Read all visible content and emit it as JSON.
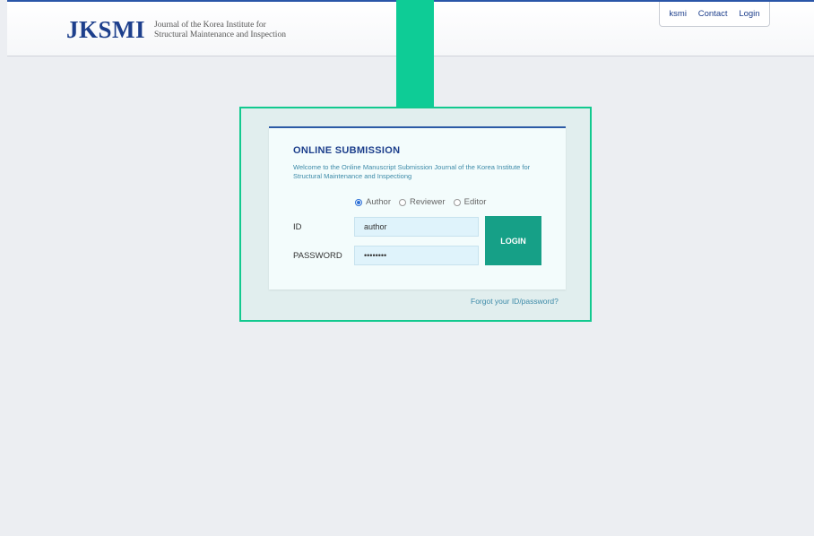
{
  "header": {
    "logo_text": "JKSMI",
    "logo_subtitle_line1": "Journal of the Korea Institute for",
    "logo_subtitle_line2": "Structural Maintenance and Inspection",
    "links": [
      "ksmi",
      "Contact",
      "Login"
    ]
  },
  "login_card": {
    "title": "ONLINE SUBMISSION",
    "description": "Welcome to the Online Manuscript Submission Journal of the Korea Institute for Structural Maintenance and Inspectiong",
    "roles": [
      {
        "label": "Author",
        "selected": true
      },
      {
        "label": "Reviewer",
        "selected": false
      },
      {
        "label": "Editor",
        "selected": false
      }
    ],
    "id_label": "ID",
    "id_value": "author",
    "password_label": "PASSWORD",
    "password_value": "••••••••",
    "login_button": "LOGIN",
    "forgot_link": "Forgot your ID/password?"
  },
  "colors": {
    "brand_blue": "#1d3f8c",
    "highlight_green": "#0ecc96",
    "login_button": "#16a087"
  }
}
